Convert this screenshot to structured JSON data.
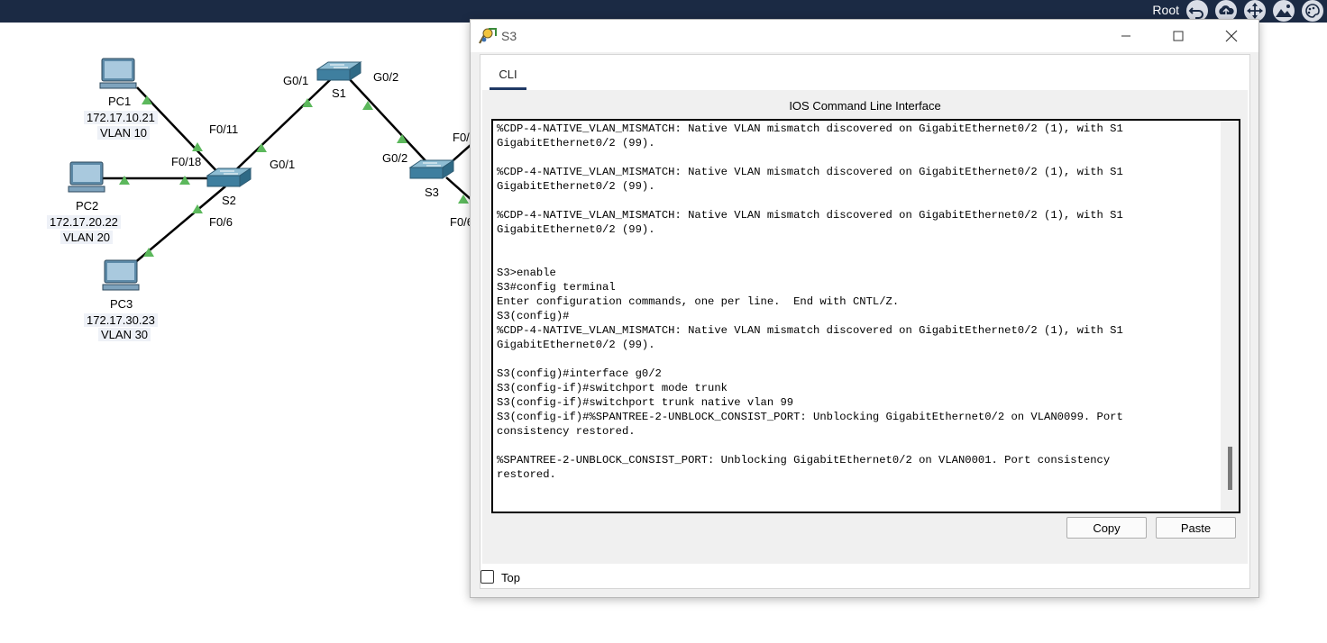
{
  "topbar": {
    "user_label": "Root"
  },
  "topology": {
    "devices": {
      "pc1": {
        "name": "PC1",
        "ip": "172.17.10.21",
        "vlan": "VLAN 10"
      },
      "pc2": {
        "name": "PC2",
        "ip": "172.17.20.22",
        "vlan": "VLAN 20"
      },
      "pc3": {
        "name": "PC3",
        "ip": "172.17.30.23",
        "vlan": "VLAN 30"
      },
      "s1": {
        "name": "S1"
      },
      "s2": {
        "name": "S2"
      },
      "s3": {
        "name": "S3"
      }
    },
    "ports": {
      "s2_f011": "F0/11",
      "s2_f018": "F0/18",
      "s2_f06": "F0/6",
      "s2_g01": "G0/1",
      "s1_g01": "G0/1",
      "s1_g02": "G0/2",
      "s3_g02": "G0/2",
      "s3_f0_top": "F0/",
      "s3_f0_bottom": "F0/6"
    },
    "link_up_color": "#5cb85c"
  },
  "window": {
    "title": "S3",
    "tab_label": "CLI",
    "heading": "IOS Command Line Interface",
    "terminal_lines": [
      "%CDP-4-NATIVE_VLAN_MISMATCH: Native VLAN mismatch discovered on GigabitEthernet0/2 (1), with S1",
      "GigabitEthernet0/2 (99).",
      "",
      "%CDP-4-NATIVE_VLAN_MISMATCH: Native VLAN mismatch discovered on GigabitEthernet0/2 (1), with S1",
      "GigabitEthernet0/2 (99).",
      "",
      "%CDP-4-NATIVE_VLAN_MISMATCH: Native VLAN mismatch discovered on GigabitEthernet0/2 (1), with S1",
      "GigabitEthernet0/2 (99).",
      "",
      "",
      "S3>enable",
      "S3#config terminal",
      "Enter configuration commands, one per line.  End with CNTL/Z.",
      "S3(config)#",
      "%CDP-4-NATIVE_VLAN_MISMATCH: Native VLAN mismatch discovered on GigabitEthernet0/2 (1), with S1",
      "GigabitEthernet0/2 (99).",
      "",
      "S3(config)#interface g0/2",
      "S3(config-if)#switchport mode trunk",
      "S3(config-if)#switchport trunk native vlan 99",
      "S3(config-if)#%SPANTREE-2-UNBLOCK_CONSIST_PORT: Unblocking GigabitEthernet0/2 on VLAN0099. Port",
      "consistency restored.",
      "",
      "%SPANTREE-2-UNBLOCK_CONSIST_PORT: Unblocking GigabitEthernet0/2 on VLAN0001. Port consistency",
      "restored."
    ],
    "copy_label": "Copy",
    "paste_label": "Paste",
    "top_checkbox_label": "Top",
    "top_checked": false
  }
}
